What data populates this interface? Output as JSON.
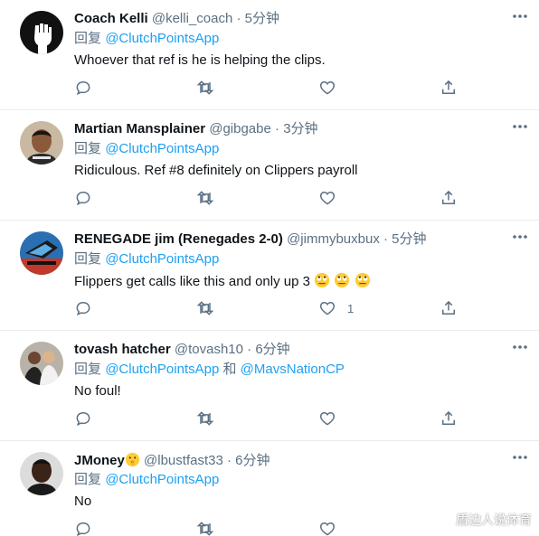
{
  "reply_prefix": "回复",
  "tweets": [
    {
      "name": "Coach Kelli",
      "handle": "@kelli_coach",
      "separator": "·",
      "time": "5分钟",
      "reply_to": [
        "@ClutchPointsApp"
      ],
      "reply_joiner": "",
      "text": "Whoever that ref is he is helping the clips.",
      "like_count": ""
    },
    {
      "name": "Martian Mansplainer",
      "handle": "@gibgabe",
      "separator": "·",
      "time": "3分钟",
      "reply_to": [
        "@ClutchPointsApp"
      ],
      "reply_joiner": "",
      "text": "Ridiculous. Ref #8 definitely on Clippers payroll",
      "like_count": ""
    },
    {
      "name": "RENEGADE jim (Renegades 2-0)",
      "handle": "@jimmybuxbux",
      "separator": "·",
      "time": "5分钟",
      "reply_to": [
        "@ClutchPointsApp"
      ],
      "reply_joiner": "",
      "text": "Flippers get calls like this and only up 3",
      "text_emoji": "eye-roll-emoji x3",
      "like_count": "1"
    },
    {
      "name": "tovash hatcher",
      "handle": "@tovash10",
      "separator": "·",
      "time": "6分钟",
      "reply_to": [
        "@ClutchPointsApp",
        "@MavsNationCP"
      ],
      "reply_joiner": "和",
      "text": "No foul!",
      "like_count": ""
    },
    {
      "name": "JMoney",
      "name_emoji": "shushing-face-emoji",
      "handle": "@lbustfast33",
      "separator": "·",
      "time": "6分钟",
      "reply_to": [
        "@ClutchPointsApp"
      ],
      "reply_joiner": "",
      "text": "No",
      "like_count": ""
    }
  ],
  "watermark": "盾边人说体育",
  "colors": {
    "text": "#0f1419",
    "muted": "#5b7083",
    "link": "#1da1f2",
    "divider": "#e6ecf0"
  }
}
